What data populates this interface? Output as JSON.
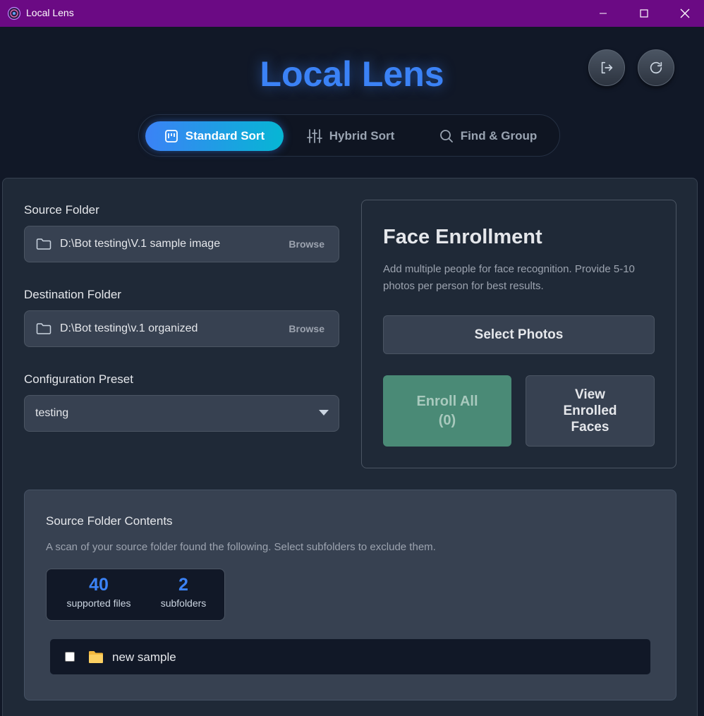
{
  "window": {
    "title": "Local Lens",
    "minimize_icon": "minimize-icon",
    "maximize_icon": "maximize-icon",
    "close_icon": "close-icon"
  },
  "header": {
    "brand": "Local Lens",
    "actions": [
      {
        "icon": "logout-icon"
      },
      {
        "icon": "refresh-icon"
      }
    ]
  },
  "tabs": [
    {
      "label": "Standard Sort",
      "icon": "board-icon",
      "active": true
    },
    {
      "label": "Hybrid Sort",
      "icon": "sliders-icon",
      "active": false
    },
    {
      "label": "Find & Group",
      "icon": "search-icon",
      "active": false
    }
  ],
  "source": {
    "label": "Source Folder",
    "path": "D:\\Bot testing\\V.1 sample image",
    "browse": "Browse"
  },
  "destination": {
    "label": "Destination Folder",
    "path": "D:\\Bot testing\\v.1 organized",
    "browse": "Browse"
  },
  "preset": {
    "label": "Configuration Preset",
    "value": "testing"
  },
  "face": {
    "title": "Face Enrollment",
    "description": "Add multiple people for face recognition. Provide 5-10 photos per person for best results.",
    "select_photos": "Select Photos",
    "enroll_line1": "Enroll All",
    "enroll_line2": "(0)",
    "view_line1": "View",
    "view_line2": "Enrolled",
    "view_line3": "Faces"
  },
  "contents": {
    "title": "Source Folder Contents",
    "description": "A scan of your source folder found the following. Select subfolders to exclude them.",
    "stats": [
      {
        "value": "40",
        "label": "supported files"
      },
      {
        "value": "2",
        "label": "subfolders"
      }
    ],
    "subfolders": [
      {
        "name": "new sample",
        "checked": false
      }
    ]
  },
  "colors": {
    "titlebar": "#6b0a84",
    "accent": "#3b82f6",
    "accent2": "#06b6d4",
    "enroll": "#4a8a76",
    "background": "#111827"
  }
}
